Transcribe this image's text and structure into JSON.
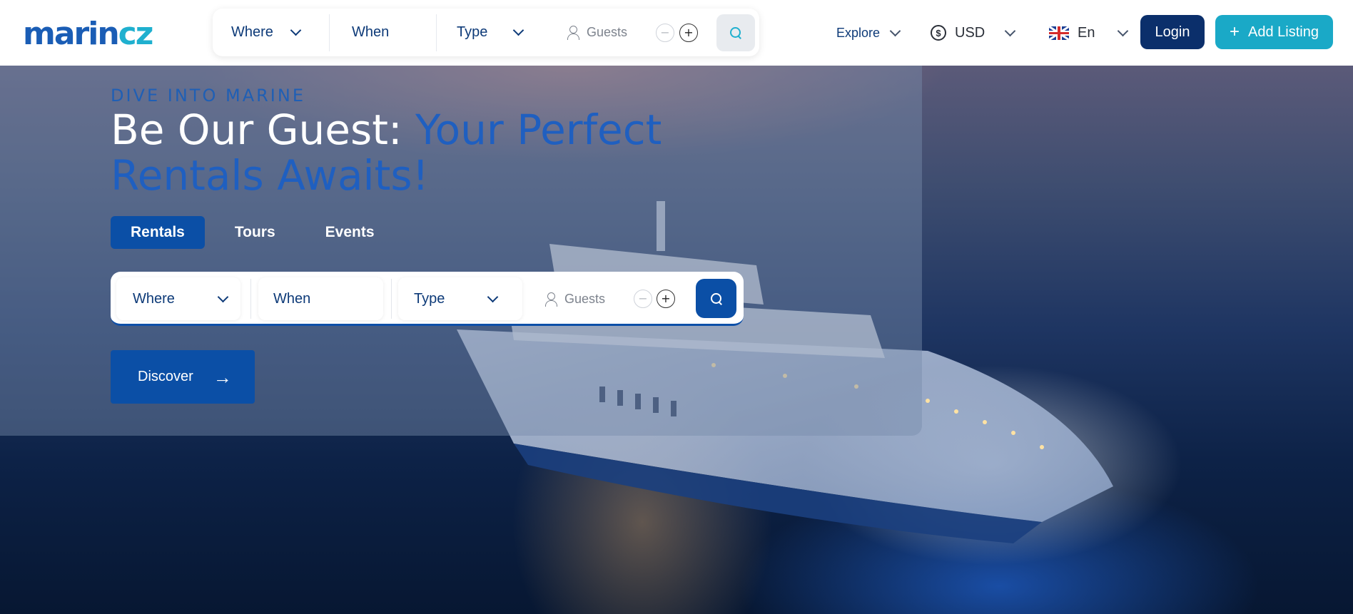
{
  "brand": {
    "logo_text": "marincz"
  },
  "header_search": {
    "where_label": "Where",
    "when_label": "When",
    "type_label": "Type",
    "guests_label": "Guests",
    "minus_symbol": "−",
    "plus_symbol": "+"
  },
  "nav": {
    "explore_label": "Explore",
    "currency_label": "USD",
    "currency_symbol": "$",
    "language_label": "En",
    "login_label": "Login",
    "add_listing_label": "Add Listing",
    "add_listing_icon": "+"
  },
  "hero": {
    "kicker": "DIVE INTO MARINE",
    "title_plain": "Be Our Guest: ",
    "title_accent": "Your Perfect Rentals Awaits!",
    "tabs": [
      {
        "label": "Rentals",
        "active": true
      },
      {
        "label": "Tours",
        "active": false
      },
      {
        "label": "Events",
        "active": false
      }
    ],
    "search": {
      "where_label": "Where",
      "when_label": "When",
      "type_label": "Type",
      "guests_label": "Guests",
      "minus_symbol": "−",
      "plus_symbol": "+"
    },
    "discover_label": "Discover",
    "discover_arrow": "→"
  },
  "colors": {
    "primary": "#0b4fa6",
    "navy": "#0b2f6b",
    "teal": "#1aa9c7",
    "accent_text": "#1f5fc0"
  }
}
